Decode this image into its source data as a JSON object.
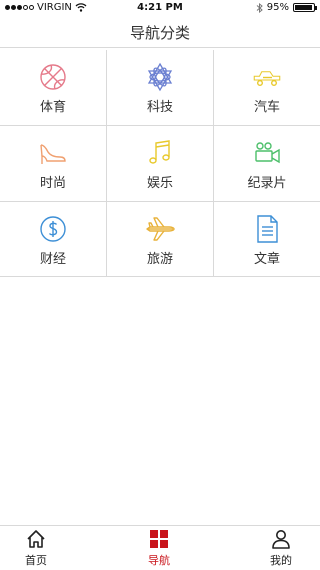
{
  "status_bar": {
    "carrier": "VIRGIN",
    "time": "4:21 PM",
    "battery": "95%",
    "battery_level": 0.95
  },
  "header": {
    "title": "导航分类"
  },
  "categories": [
    {
      "label": "体育",
      "icon": "basketball-icon",
      "color": "#e57a8a"
    },
    {
      "label": "科技",
      "icon": "atom-star-icon",
      "color": "#6a7fd1"
    },
    {
      "label": "汽车",
      "icon": "car-icon",
      "color": "#e8c92b"
    },
    {
      "label": "时尚",
      "icon": "high-heel-icon",
      "color": "#f0a070"
    },
    {
      "label": "娱乐",
      "icon": "music-note-icon",
      "color": "#e8c92b"
    },
    {
      "label": "纪录片",
      "icon": "video-camera-icon",
      "color": "#4cbf6a"
    },
    {
      "label": "财经",
      "icon": "dollar-coin-icon",
      "color": "#3d8fd6"
    },
    {
      "label": "旅游",
      "icon": "airplane-icon",
      "color": "#e8b23a"
    },
    {
      "label": "文章",
      "icon": "document-icon",
      "color": "#3d8fd6"
    }
  ],
  "tabbar": {
    "tabs": [
      {
        "label": "首页",
        "icon": "home-icon"
      },
      {
        "label": "导航",
        "icon": "grid-icon",
        "active": true
      },
      {
        "label": "我的",
        "icon": "user-icon"
      }
    ],
    "active_color": "#c9141b"
  }
}
